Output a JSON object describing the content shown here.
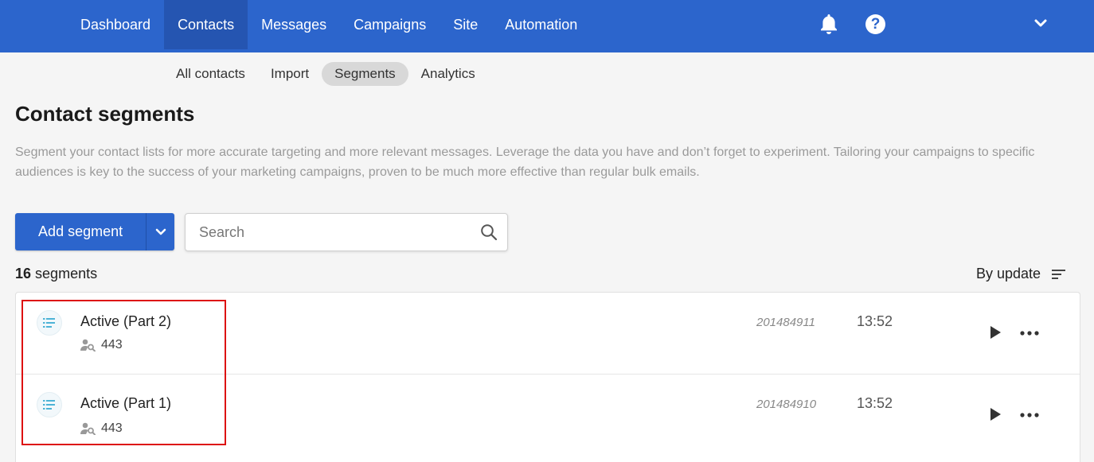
{
  "topnav": {
    "items": [
      {
        "label": "Dashboard"
      },
      {
        "label": "Contacts"
      },
      {
        "label": "Messages"
      },
      {
        "label": "Campaigns"
      },
      {
        "label": "Site"
      },
      {
        "label": "Automation"
      }
    ],
    "active": "Contacts",
    "help_glyph": "?",
    "icons": [
      "bell-icon",
      "help-icon",
      "chevron-down-icon"
    ]
  },
  "subnav": {
    "items": [
      {
        "label": "All contacts"
      },
      {
        "label": "Import"
      },
      {
        "label": "Segments"
      },
      {
        "label": "Analytics"
      }
    ],
    "active": "Segments"
  },
  "page": {
    "title": "Contact segments",
    "description": "Segment your contact lists for more accurate targeting and more relevant messages. Leverage the data you have and don’t forget to experiment. Tailoring your campaigns to specific audiences is key to the success of your marketing campaigns, proven to be much more effective than regular bulk emails."
  },
  "toolbar": {
    "add_label": "Add segment",
    "search_placeholder": "Search",
    "search_value": ""
  },
  "summary": {
    "count": "16",
    "count_suffix": "segments",
    "sort_label": "By update"
  },
  "segments": [
    {
      "name": "Active (Part 2)",
      "contacts": "443",
      "id": "201484911",
      "time": "13:52"
    },
    {
      "name": "Active (Part 1)",
      "contacts": "443",
      "id": "201484910",
      "time": "13:52"
    }
  ],
  "colors": {
    "brand": "#2c65cc",
    "nav_active": "#2555b1",
    "highlight": "#dd1111",
    "segment_icon": "#4db3d6"
  }
}
